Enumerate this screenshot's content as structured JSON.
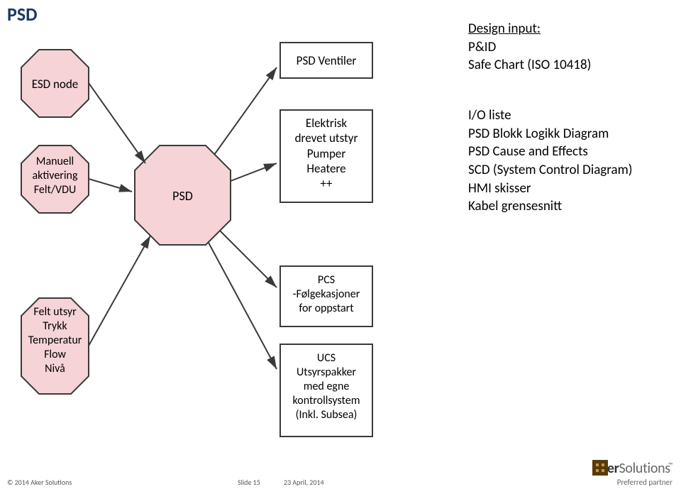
{
  "title": "PSD",
  "shapes": {
    "esd_node": "ESD node",
    "manuell": "Manuell\naktivering\nFelt/VDU",
    "felt_utsyr": "Felt utsyr\nTrykk\nTemperatur\nFlow\nNivå",
    "psd_center": "PSD",
    "psd_ventiler": "PSD Ventiler",
    "elektrisk": "Elektrisk\ndrevet utstyr\nPumper\nHeatere\n++",
    "pcs": "PCS\n-Følgekasjoner\nfor oppstart",
    "ucs": "UCS\nUtsyrspakker\nmed egne\nkontrollsystem\n(Inkl. Subsea)"
  },
  "design": {
    "heading": "Design input:",
    "items": [
      "P&ID",
      "Safe Chart (ISO 10418)"
    ]
  },
  "outputs": {
    "items": [
      "I/O liste",
      "PSD Blokk Logikk Diagram",
      "PSD Cause and Effects",
      "SCD (System Control Diagram)",
      "HMI skisser",
      "Kabel grensesnitt"
    ]
  },
  "footer": {
    "copyright": "© 2014 Aker Solutions",
    "slide": "Slide 15",
    "date": "23 April, 2014",
    "preferred": "Preferred partner",
    "brand_a": "Aker",
    "brand_b": "Solutions"
  }
}
